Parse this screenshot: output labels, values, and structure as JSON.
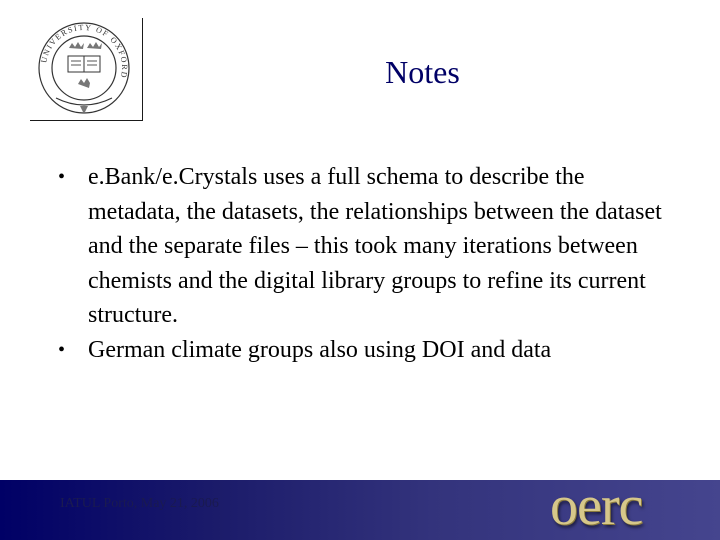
{
  "logo": {
    "icon": "university-of-oxford-seal-icon",
    "ring_text": "UNIVERSITY OF OXFORD"
  },
  "slide": {
    "title": "Notes",
    "bullets": [
      {
        "text": "e.Bank/e.Crystals uses a full schema to describe the metadata, the datasets, the relationships between the dataset and the separate files – this took many iterations between chemists and the digital library groups to refine its current structure."
      },
      {
        "text": "German climate groups also using DOI and data"
      }
    ],
    "bullet_glyph": "•"
  },
  "footer": {
    "text": "IATUL Porto, May 21, 2006",
    "brand": "oerc",
    "colors": {
      "start": "#000066",
      "end": "#45458e",
      "brand_gold": "#d6c78a"
    }
  },
  "colors": {
    "title": "#000066",
    "body": "#000000"
  }
}
